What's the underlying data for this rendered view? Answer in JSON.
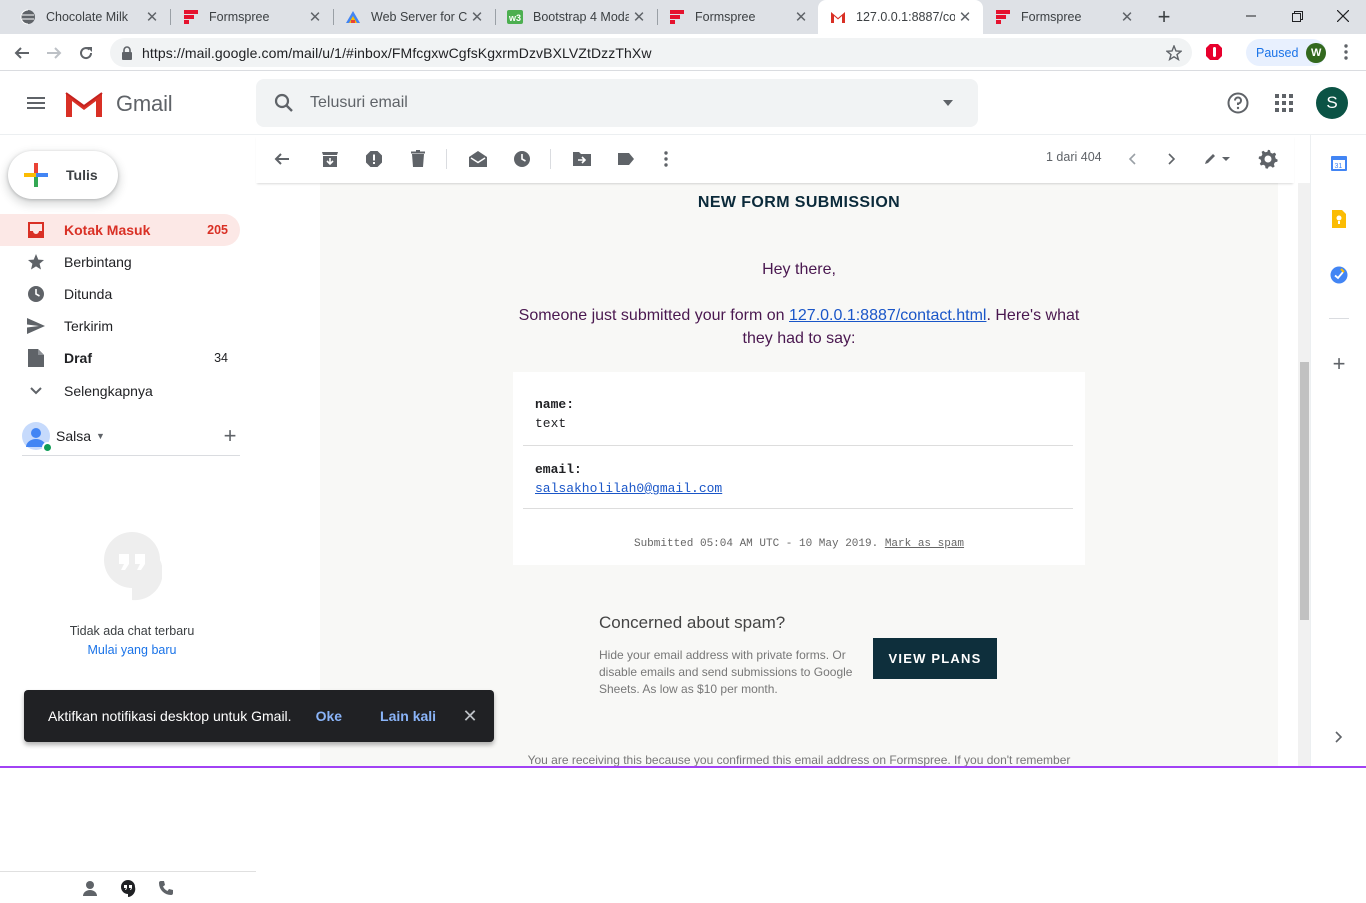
{
  "browser": {
    "tabs": [
      {
        "title": "Chocolate Milk",
        "favicon": "globe-icon"
      },
      {
        "title": "Formspree",
        "favicon": "formspree-icon"
      },
      {
        "title": "Web Server for Ch",
        "favicon": "chrome-app-icon"
      },
      {
        "title": "Bootstrap 4 Moda",
        "favicon": "w3-icon"
      },
      {
        "title": "Formspree",
        "favicon": "formspree-icon"
      },
      {
        "title": "127.0.0.1:8887/co",
        "favicon": "gmail-icon"
      },
      {
        "title": "Formspree",
        "favicon": "formspree-icon"
      }
    ],
    "active_tab": 5,
    "url": "https://mail.google.com/mail/u/1/#inbox/FMfcgxwCgfsKgxrmDzvBXLVZtDzzThXw",
    "profile_status": "Paused",
    "profile_initial": "W"
  },
  "gmail": {
    "wordmark": "Gmail",
    "search_placeholder": "Telusuri email",
    "avatar_initial": "S",
    "compose_label": "Tulis",
    "nav": [
      {
        "label": "Kotak Masuk",
        "count": "205",
        "icon": "inbox-icon"
      },
      {
        "label": "Berbintang",
        "count": "",
        "icon": "star-icon"
      },
      {
        "label": "Ditunda",
        "count": "",
        "icon": "clock-icon"
      },
      {
        "label": "Terkirim",
        "count": "",
        "icon": "send-icon"
      },
      {
        "label": "Draf",
        "count": "34",
        "icon": "draft-icon"
      },
      {
        "label": "Selengkapnya",
        "count": "",
        "icon": "chevron-down-icon"
      }
    ],
    "hangouts": {
      "user": "Salsa",
      "no_chat": "Tidak ada chat terbaru",
      "start_new": "Mulai yang baru"
    },
    "toolbar": {
      "pager": "1 dari 404"
    },
    "toast": {
      "message": "Aktifkan notifikasi desktop untuk Gmail.",
      "ok": "Oke",
      "later": "Lain kali"
    }
  },
  "email": {
    "title": "NEW FORM SUBMISSION",
    "greeting": "Hey there,",
    "intro_before": "Someone just submitted your form on ",
    "intro_link": "127.0.0.1:8887/contact.html",
    "intro_after": ". Here's what they had to say:",
    "fields": [
      {
        "key": "name:",
        "value": "text"
      },
      {
        "key": "email:",
        "value": "salsakholilah0@gmail.com"
      }
    ],
    "submitted": "Submitted 05:04 AM UTC - 10 May 2019. ",
    "mark_spam": "Mark as spam",
    "spam_heading": "Concerned about spam?",
    "spam_text": "Hide your email address with private forms. Or disable emails and send submissions to Google Sheets. As low as $10 per month.",
    "view_plans": "VIEW PLANS",
    "footer_note": "You are receiving this because you confirmed this email address on Formspree. If you don't remember"
  },
  "colors": {
    "gmail_red": "#d93025",
    "inbox_bg": "#fce8e6",
    "formspree_dark": "#0e2f3c",
    "email_text": "#4a1850",
    "link": "#1a56c8"
  }
}
